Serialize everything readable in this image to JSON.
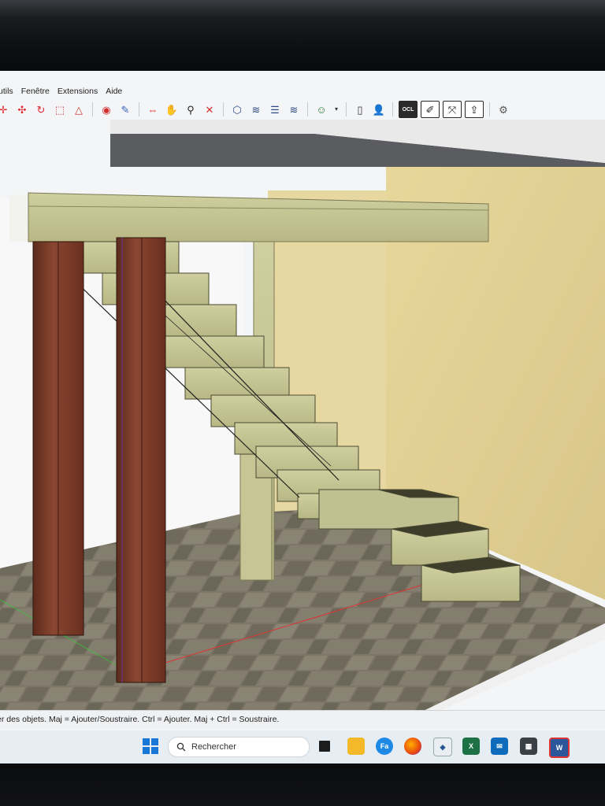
{
  "menu": {
    "items": [
      "utils",
      "Fenêtre",
      "Extensions",
      "Aide"
    ]
  },
  "toolbar": {
    "icons": [
      "move-tool-icon",
      "select-arrows-icon",
      "rotate-icon",
      "scale-icon",
      "warning-triangle-icon",
      "paint-bucket-icon",
      "paint-icon",
      "flip-icon",
      "tape-measure-icon",
      "search-zoom-icon",
      "zoom-extents-icon",
      "3d-warehouse-icon",
      "layers-icon",
      "layers-add-icon",
      "components-icon",
      "user-profile-icon",
      "new-document-icon",
      "person-icon",
      "ocl-icon",
      "pencil-icon",
      "axes-icon",
      "export-icon",
      "robot-icon"
    ],
    "ocl_label": "OCL"
  },
  "status": {
    "text": "er des objets. Maj = Ajouter/Soustraire. Ctrl = Ajouter. Maj + Ctrl = Soustraire."
  },
  "taskbar": {
    "search_placeholder": "Rechercher",
    "apps": [
      "start-button",
      "search-bar",
      "task-view-icon",
      "file-explorer-icon",
      "facebook-icon",
      "firefox-icon",
      "sketchup-icon",
      "excel-icon",
      "outlook-icon",
      "calculator-icon",
      "word-icon"
    ],
    "fa_label": "Fa",
    "excel_label": "X",
    "word_label": "W"
  },
  "colors": {
    "accent_blue": "#1677d6",
    "wood_light": "#c9c79a",
    "wood_dark_post": "#7a3a26",
    "wall_insulation": "#dfcf92",
    "floor_tile": "#7b7466"
  }
}
